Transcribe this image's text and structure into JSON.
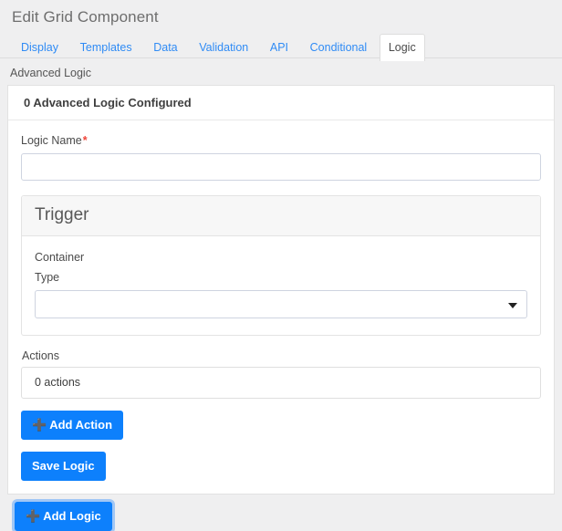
{
  "window": {
    "title": "Edit Grid Component"
  },
  "tabs": [
    {
      "label": "Display",
      "active": false
    },
    {
      "label": "Templates",
      "active": false
    },
    {
      "label": "Data",
      "active": false
    },
    {
      "label": "Validation",
      "active": false
    },
    {
      "label": "API",
      "active": false
    },
    {
      "label": "Conditional",
      "active": false
    },
    {
      "label": "Logic",
      "active": true
    }
  ],
  "advanced_logic": {
    "section_label": "Advanced Logic",
    "summary": "0 Advanced Logic Configured",
    "logic_name": {
      "label": "Logic Name",
      "required_marker": "*",
      "value": "",
      "placeholder": ""
    },
    "trigger": {
      "title": "Trigger",
      "container_label": "Container",
      "type_label": "Type",
      "type_value": "",
      "type_caret_icon": "chevron-down-icon"
    },
    "actions": {
      "label": "Actions",
      "empty_text": "0 actions",
      "add_action_button": "Add Action",
      "add_action_icon": "plus-icon"
    },
    "save_logic_button": "Save Logic",
    "add_logic_button": "Add Logic",
    "add_logic_icon": "plus-icon"
  },
  "colors": {
    "accent_blue": "#0d80fc",
    "tab_link_blue": "#2f8bf5",
    "required_red": "#f0453a",
    "page_background": "#efeff0",
    "panel_background": "#ffffff",
    "trigger_header_background": "#f7f7f7",
    "border_gray": "#dddddd",
    "input_border": "#ced4e0"
  }
}
